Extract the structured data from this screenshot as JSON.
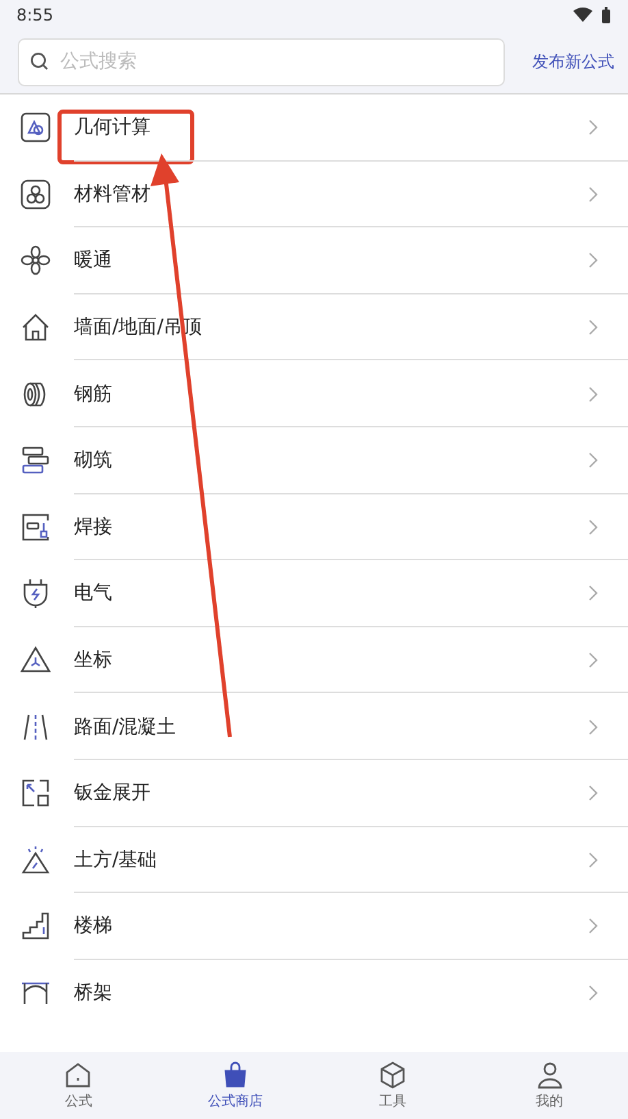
{
  "status_bar": {
    "time": "8:55"
  },
  "search": {
    "placeholder": "公式搜索"
  },
  "publish_link": "发布新公式",
  "categories": [
    {
      "label": "几何计算",
      "highlighted": true
    },
    {
      "label": "材料管材",
      "highlighted": false
    },
    {
      "label": "暖通",
      "highlighted": false
    },
    {
      "label": "墙面/地面/吊顶",
      "highlighted": false
    },
    {
      "label": "钢筋",
      "highlighted": false
    },
    {
      "label": "砌筑",
      "highlighted": false
    },
    {
      "label": "焊接",
      "highlighted": false
    },
    {
      "label": "电气",
      "highlighted": false
    },
    {
      "label": "坐标",
      "highlighted": false
    },
    {
      "label": "路面/混凝土",
      "highlighted": false
    },
    {
      "label": "钣金展开",
      "highlighted": false
    },
    {
      "label": "土方/基础",
      "highlighted": false
    },
    {
      "label": "楼梯",
      "highlighted": false
    },
    {
      "label": "桥架",
      "highlighted": false
    }
  ],
  "bottom_nav": [
    {
      "label": "公式",
      "selected": false
    },
    {
      "label": "公式商店",
      "selected": true
    },
    {
      "label": "工具",
      "selected": false
    },
    {
      "label": "我的",
      "selected": false
    }
  ]
}
